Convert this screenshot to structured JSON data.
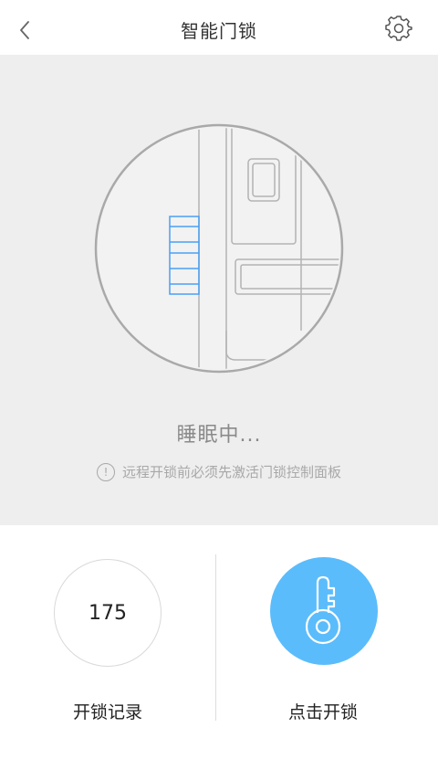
{
  "header": {
    "title": "智能门锁",
    "back_icon": "chevron-left-icon",
    "settings_icon": "gear-icon"
  },
  "device": {
    "status": "睡眠中...",
    "hint": "远程开锁前必须先激活门锁控制面板",
    "hint_icon": "exclamation-circle-icon",
    "accent_color": "#4a9ff5"
  },
  "actions": {
    "record_count": "175",
    "record_label": "开锁记录",
    "unlock_label": "点击开锁",
    "unlock_icon": "key-icon",
    "unlock_color": "#5bbcfb"
  }
}
